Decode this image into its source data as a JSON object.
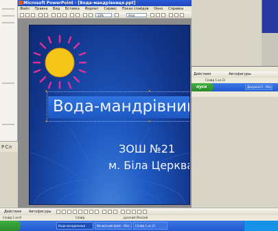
{
  "window": {
    "title": "Microsoft PowerPoint - [Вода-мандрівниця.ppt]"
  },
  "menu": {
    "items": [
      "Файл",
      "Правка",
      "Вид",
      "Вставка",
      "Формат",
      "Сервис",
      "Показ слайдов",
      "Окно",
      "Справка"
    ]
  },
  "toolbar": {
    "zoom": "33%",
    "font": "Arial"
  },
  "slide": {
    "title": "Вода-мандрівниця",
    "line1": "ЗОШ №21",
    "line2": "м. Біла Церква",
    "colors": {
      "background": "#12368c",
      "title_band": "#2f74e0",
      "sun": "#f5c518",
      "rays": "#e0309a"
    }
  },
  "floating_window": {
    "actions_label": "Действия",
    "autoshapes_label": "Автофигуры",
    "status": "Слайд 1 из 21",
    "start_label": "пуск",
    "task_label": "Документ1 - Micr..."
  },
  "drawing_toolbar": {
    "actions_label": "Действия",
    "autoshapes_label": "Автофигуры"
  },
  "status_bar": {
    "slide": "Слайд 1 из 8",
    "design": "Слайд",
    "language": "русский (Россия)"
  },
  "taskbar": {
    "tasks": [
      "Вода-мандрівниця",
      "Вичерпний файл - Micr...",
      "Слайд 1 из 21"
    ]
  },
  "left_panel": {
    "bottom_label": "Р Сл"
  }
}
